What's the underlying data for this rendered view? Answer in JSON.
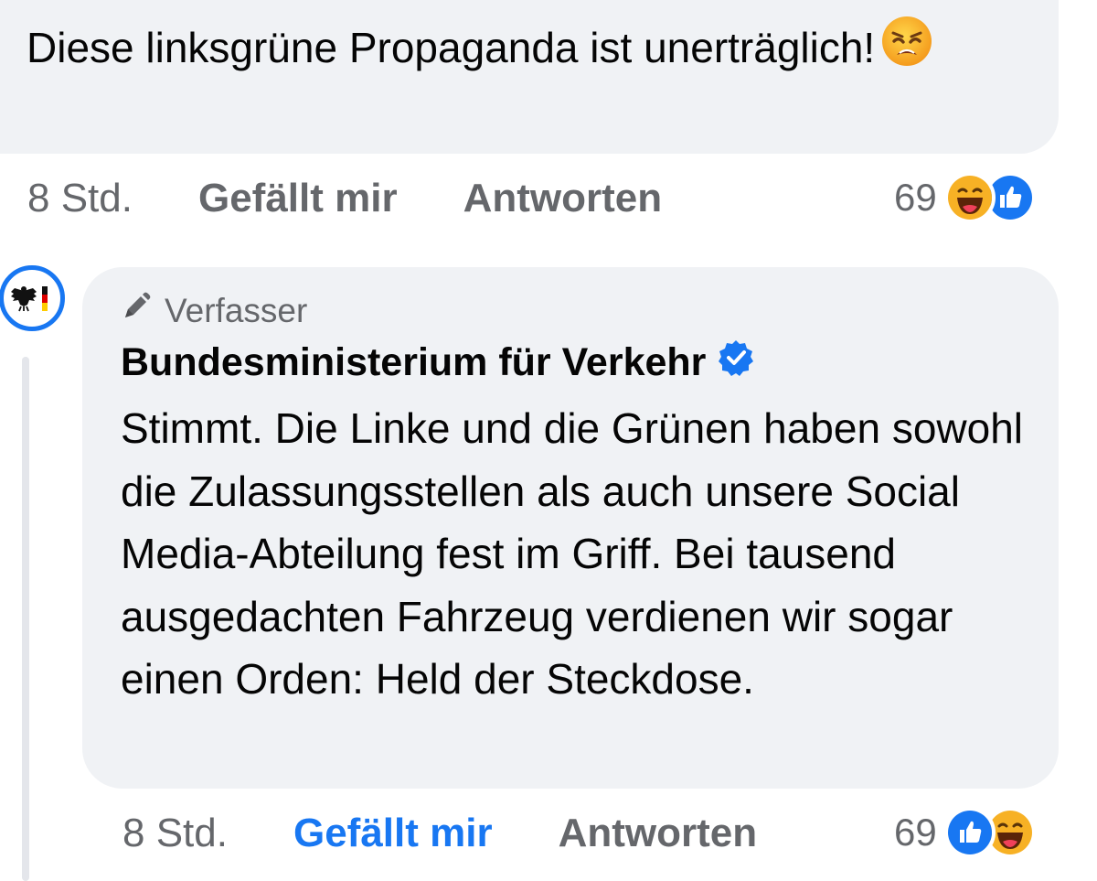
{
  "top_comment": {
    "text": "Diese linksgrüne Propaganda ist unerträglich!",
    "emoji_icon": "weary-face-emoji",
    "time": "8 Std.",
    "like_label": "Gefällt mir",
    "reply_label": "Antworten",
    "reaction_count": "69",
    "reaction_icons": [
      "haha-reaction-icon",
      "like-reaction-icon"
    ]
  },
  "reply": {
    "author_badge": "Verfasser",
    "author_badge_icon": "pencil-icon",
    "author_name": "Bundesministerium für Verkehr",
    "verified_icon": "verified-badge-icon",
    "avatar_icon": "federal-eagle-icon",
    "text": "Stimmt. Die Linke und die Grünen haben sowohl die Zulassungsstellen als auch unsere Social Media-Abteilung fest im Griff. Bei tausend ausgedachten Fahrzeug verdienen wir sogar einen Orden: Held der Steckdose.",
    "time": "8 Std.",
    "like_label": "Gefällt mir",
    "like_active": true,
    "reply_label": "Antworten",
    "reaction_count": "69",
    "reaction_icons": [
      "like-reaction-icon",
      "haha-reaction-icon"
    ]
  },
  "colors": {
    "bubble": "#f0f2f5",
    "meta_text": "#65676b",
    "accent_blue": "#1877f2",
    "text": "#050505",
    "haha_yellow": "#f7b125"
  }
}
